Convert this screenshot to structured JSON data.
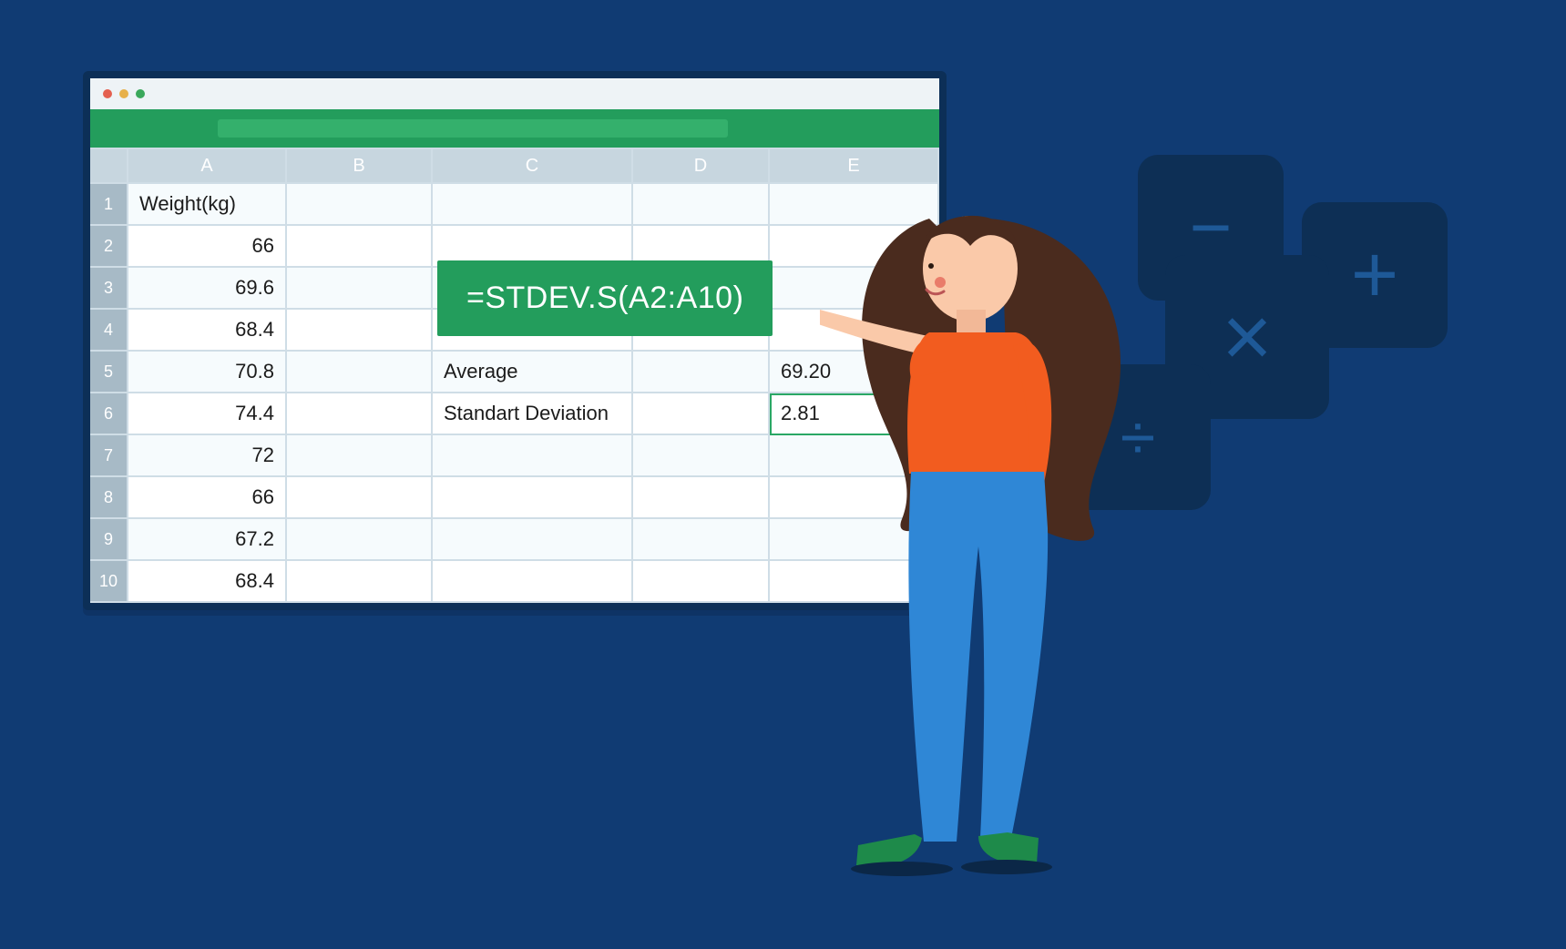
{
  "columns": [
    "",
    "A",
    "B",
    "C",
    "D",
    "E"
  ],
  "rows": [
    {
      "n": "1",
      "a": "Weight(kg)",
      "b": "",
      "c": "",
      "d": "",
      "e": ""
    },
    {
      "n": "2",
      "a": "66",
      "b": "",
      "c": "",
      "d": "",
      "e": ""
    },
    {
      "n": "3",
      "a": "69.6",
      "b": "",
      "c": "",
      "d": "",
      "e": ""
    },
    {
      "n": "4",
      "a": "68.4",
      "b": "",
      "c": "",
      "d": "",
      "e": ""
    },
    {
      "n": "5",
      "a": "70.8",
      "b": "",
      "c": "Average",
      "d": "",
      "e": "69.20"
    },
    {
      "n": "6",
      "a": "74.4",
      "b": "",
      "c": "Standart Deviation",
      "d": "",
      "e": "2.81"
    },
    {
      "n": "7",
      "a": "72",
      "b": "",
      "c": "",
      "d": "",
      "e": ""
    },
    {
      "n": "8",
      "a": "66",
      "b": "",
      "c": "",
      "d": "",
      "e": ""
    },
    {
      "n": "9",
      "a": "67.2",
      "b": "",
      "c": "",
      "d": "",
      "e": ""
    },
    {
      "n": "10",
      "a": "68.4",
      "b": "",
      "c": "",
      "d": "",
      "e": ""
    }
  ],
  "formula": "=STDEV.S(A2:A10)",
  "tiles": {
    "minus": "−",
    "plus": "+",
    "times": "×",
    "divide": "÷"
  },
  "colors": {
    "bg": "#103b73",
    "accent": "#239d5c",
    "tile": "#0d2f55",
    "tileFg": "#1e5997"
  }
}
